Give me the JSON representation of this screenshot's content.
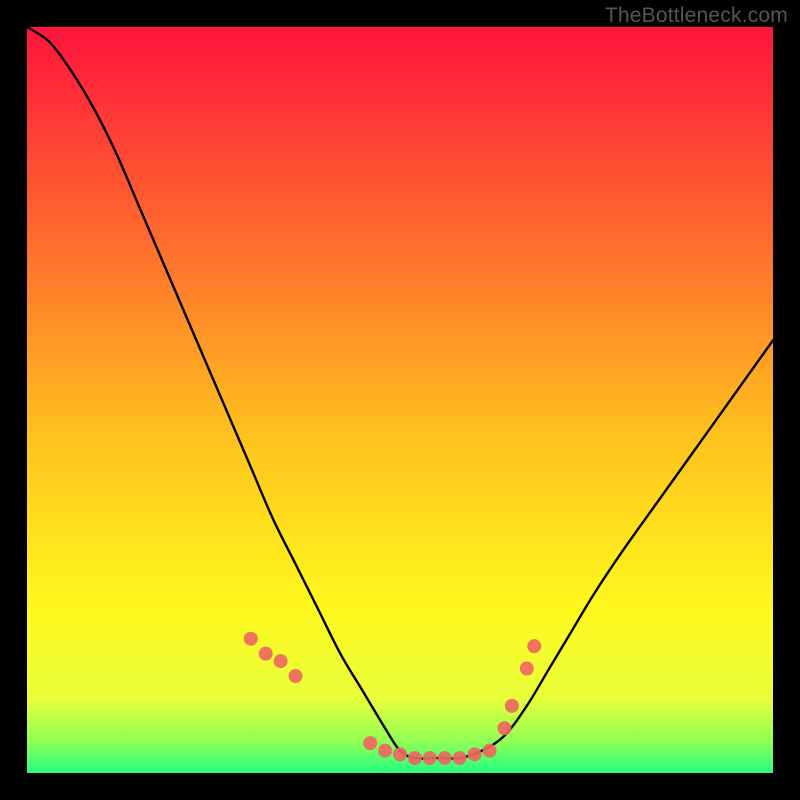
{
  "watermark": "TheBottleneck.com",
  "colors": {
    "gradient_top": "#ff143c",
    "gradient_mid1": "#ff7a2a",
    "gradient_mid2": "#ffd91e",
    "gradient_mid3": "#faff32",
    "gradient_bottom": "#2cff7e",
    "curve": "#000000",
    "marker": "#ef6762",
    "frame": "#000000"
  },
  "chart_data": {
    "type": "line",
    "title": "",
    "xlabel": "",
    "ylabel": "",
    "xlim": [
      0,
      100
    ],
    "ylim": [
      0,
      100
    ],
    "grid": false,
    "legend": false,
    "series": [
      {
        "name": "bottleneck-curve",
        "x": [
          0,
          3,
          6,
          9,
          12,
          15,
          18,
          21,
          24,
          27,
          30,
          33,
          36,
          39,
          42,
          45,
          48,
          50,
          52,
          55,
          58,
          61,
          64,
          67,
          70,
          73,
          76,
          80,
          85,
          90,
          95,
          100
        ],
        "y": [
          100,
          98,
          94,
          89,
          83,
          76,
          69,
          62,
          55,
          48,
          41,
          34,
          28,
          22,
          16,
          11,
          6,
          3,
          2,
          2,
          2,
          3,
          5,
          9,
          14,
          19,
          24,
          30,
          37,
          44,
          51,
          58
        ]
      }
    ],
    "markers": {
      "name": "highlight-dots",
      "x": [
        30,
        32,
        34,
        36,
        46,
        48,
        50,
        52,
        54,
        56,
        58,
        60,
        62,
        64,
        65,
        67,
        68
      ],
      "y": [
        18,
        16,
        15,
        13,
        4,
        3,
        2.5,
        2,
        2,
        2,
        2,
        2.5,
        3,
        6,
        9,
        14,
        17
      ]
    }
  }
}
